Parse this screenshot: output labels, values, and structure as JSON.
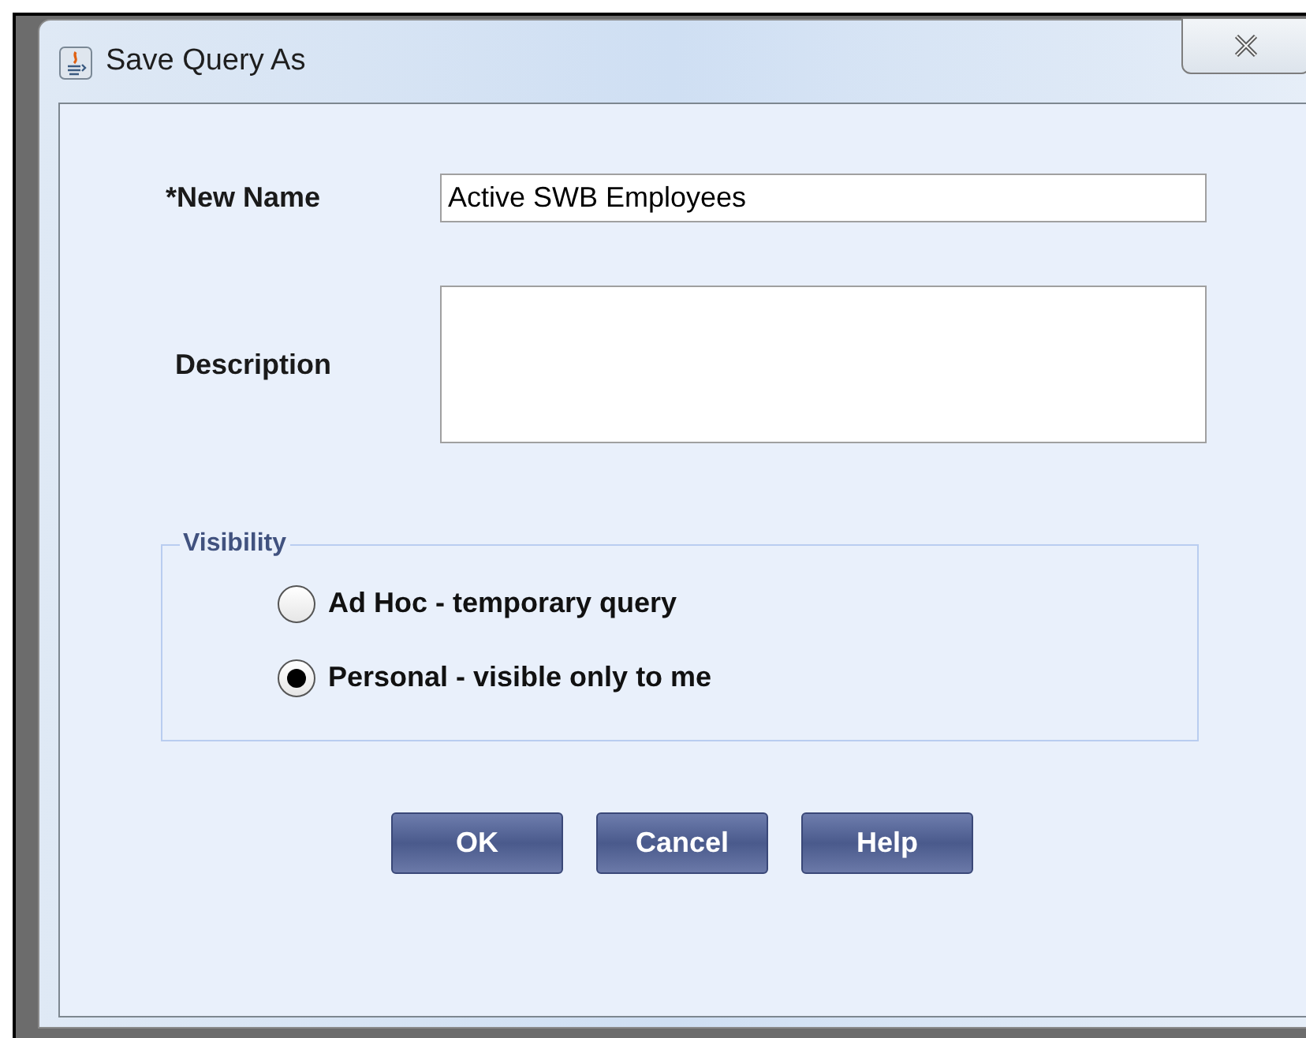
{
  "window": {
    "title": "Save Query As"
  },
  "fields": [
    {
      "kind": "line",
      "label": "*New Name",
      "value": "Active SWB Employees"
    },
    {
      "kind": "area",
      "label": "Description"
    }
  ],
  "visibility": {
    "legend": "Visibility",
    "options": [
      {
        "label": "Ad Hoc - temporary query",
        "selected": false
      },
      {
        "label": "Personal - visible only to me",
        "selected": true
      }
    ]
  },
  "buttons": [
    "OK",
    "Cancel",
    "Help"
  ]
}
